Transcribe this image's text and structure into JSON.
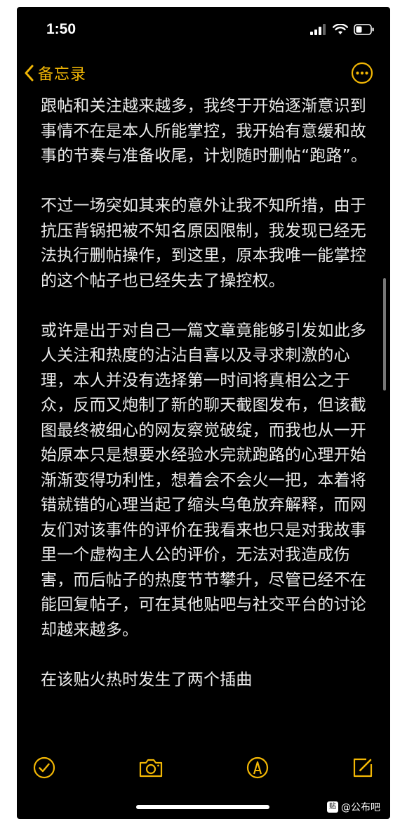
{
  "status_bar": {
    "time": "1:50"
  },
  "nav": {
    "back_label": "备忘录",
    "back_icon": "chevron-left-icon",
    "more_icon": "ellipsis-circle-icon"
  },
  "accent_color": "#f2b705",
  "note": {
    "paragraphs": [
      "跟帖和关注越来越多，我终于开始逐渐意识到事情不在是本人所能掌控，我开始有意缓和故事的节奏与准备收尾，计划随时删帖“跑路”。",
      "不过一场突如其来的意外让我不知所措，由于抗压背锅把被不知名原因限制，我发现已经无法执行删帖操作，到这里，原本我唯一能掌控的这个帖子也已经失去了操控权。",
      "或许是出于对自己一篇文章竟能够引发如此多人关注和热度的沾沾自喜以及寻求刺激的心理，本人并没有选择第一时间将真相公之于众，反而又炮制了新的聊天截图发布，但该截图最终被细心的网友察觉破绽，而我也从一开始原本只是想要水经验水完就跑路的心理开始渐渐变得功利性，想着会不会火一把，本着将错就错的心理当起了缩头乌龟放弃解释，而网友们对该事件的评价在我看来也只是对我故事里一个虚构主人公的评价，无法对我造成伤害，而后帖子的热度节节攀升，尽管已经不在能回复帖子，可在其他贴吧与社交平台的讨论却越来越多。",
      "在该贴火热时发生了两个插曲"
    ]
  },
  "toolbar": {
    "items": [
      "checklist-icon",
      "camera-icon",
      "markup-icon",
      "compose-icon"
    ]
  },
  "watermark": {
    "box": "贴",
    "text": "@公布吧"
  }
}
